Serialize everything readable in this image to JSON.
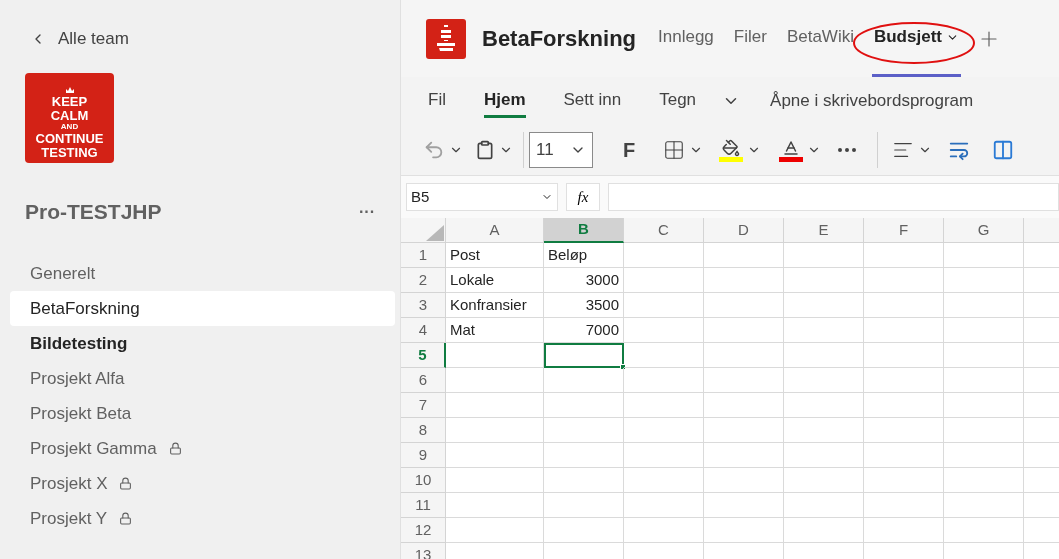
{
  "sidebar": {
    "back_label": "Alle team",
    "logo_lines": [
      "KEEP",
      "CALM",
      "AND",
      "CONTINUE",
      "TESTING"
    ],
    "team_name": "Pro-TESTJHP",
    "more_label": "···",
    "channels": [
      {
        "name": "Generelt",
        "selected": false,
        "unread": false,
        "locked": false
      },
      {
        "name": "BetaForskning",
        "selected": true,
        "unread": false,
        "locked": false
      },
      {
        "name": "Bildetesting",
        "selected": false,
        "unread": true,
        "locked": false
      },
      {
        "name": "Prosjekt Alfa",
        "selected": false,
        "unread": false,
        "locked": false
      },
      {
        "name": "Prosjekt Beta",
        "selected": false,
        "unread": false,
        "locked": false
      },
      {
        "name": "Prosjekt Gamma",
        "selected": false,
        "unread": false,
        "locked": true
      },
      {
        "name": "Prosjekt X",
        "selected": false,
        "unread": false,
        "locked": true
      },
      {
        "name": "Prosjekt Y",
        "selected": false,
        "unread": false,
        "locked": true
      }
    ]
  },
  "channel_header": {
    "title": "BetaForskning",
    "tabs": [
      {
        "label": "Innlegg",
        "selected": false
      },
      {
        "label": "Filer",
        "selected": false
      },
      {
        "label": "BetaWiki",
        "selected": false
      },
      {
        "label": "Budsjett",
        "selected": true
      }
    ]
  },
  "ribbon": {
    "tabs": [
      {
        "label": "Fil",
        "selected": false
      },
      {
        "label": "Hjem",
        "selected": true
      },
      {
        "label": "Sett inn",
        "selected": false
      },
      {
        "label": "Tegn",
        "selected": false
      }
    ],
    "open_desktop": "Åpne i skrivebordsprogram",
    "font_size": "11",
    "bold_label": "F"
  },
  "formula_bar": {
    "name_box": "B5",
    "fx": "fx"
  },
  "sheet": {
    "columns": [
      {
        "label": "A",
        "selected": false
      },
      {
        "label": "B",
        "selected": true
      },
      {
        "label": "C",
        "selected": false
      },
      {
        "label": "D",
        "selected": false
      },
      {
        "label": "E",
        "selected": false
      },
      {
        "label": "F",
        "selected": false
      },
      {
        "label": "G",
        "selected": false
      }
    ],
    "rows": [
      {
        "label": "1",
        "selected": false,
        "cells": [
          {
            "text": "Post",
            "kind": "text"
          },
          {
            "text": "Beløp",
            "kind": "text"
          }
        ]
      },
      {
        "label": "2",
        "selected": false,
        "cells": [
          {
            "text": "Lokale",
            "kind": "text"
          },
          {
            "text": "3000",
            "kind": "number"
          }
        ]
      },
      {
        "label": "3",
        "selected": false,
        "cells": [
          {
            "text": "Konfransier",
            "kind": "text"
          },
          {
            "text": "3500",
            "kind": "number"
          }
        ]
      },
      {
        "label": "4",
        "selected": false,
        "cells": [
          {
            "text": "Mat",
            "kind": "text"
          },
          {
            "text": "7000",
            "kind": "number"
          }
        ]
      },
      {
        "label": "5",
        "selected": true,
        "cells": []
      },
      {
        "label": "6",
        "selected": false,
        "cells": []
      },
      {
        "label": "7",
        "selected": false,
        "cells": []
      },
      {
        "label": "8",
        "selected": false,
        "cells": []
      },
      {
        "label": "9",
        "selected": false,
        "cells": []
      },
      {
        "label": "10",
        "selected": false,
        "cells": []
      },
      {
        "label": "11",
        "selected": false,
        "cells": []
      },
      {
        "label": "12",
        "selected": false,
        "cells": []
      },
      {
        "label": "13",
        "selected": false,
        "cells": []
      }
    ]
  }
}
